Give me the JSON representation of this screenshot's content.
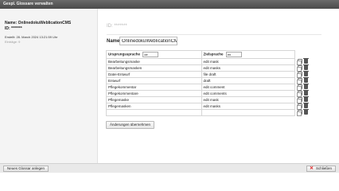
{
  "window": {
    "title": "Gespl. Glossare verwalten"
  },
  "sidebar": {
    "name": "Name: OnlinedokuWebIicationCMS",
    "id": "ID: *******",
    "created": "Erstellt: 28. March 2024 13:21:59 Uhr",
    "entries": "Einträge: 9"
  },
  "detail": {
    "id_display": "ID: *******",
    "name_label": "Name",
    "name_value": "OnlinedokuWebIicationCM",
    "source_lang_label": "Ursprungssprache",
    "source_lang_value": "de",
    "target_lang_label": "Zielsprache",
    "target_lang_value": "en",
    "rows": [
      {
        "source": "Bearbeitungsmaske",
        "target": "edit mask"
      },
      {
        "source": "Bearbeitungsmasken",
        "target": "edit masks"
      },
      {
        "source": "Datei-Entwurf",
        "target": "file draft"
      },
      {
        "source": "Entwurf",
        "target": "draft"
      },
      {
        "source": "Pflegekommentar",
        "target": "edit comment"
      },
      {
        "source": "Pflegekommentare",
        "target": "edit comments"
      },
      {
        "source": "Pflegemaske",
        "target": "edit mask"
      },
      {
        "source": "Pflegemasken",
        "target": "edit masks"
      },
      {
        "source": "",
        "target": ""
      }
    ],
    "apply_label": "Änderungen übernehmen"
  },
  "footer": {
    "new_label": "Neues Glossar anlegen",
    "close_label": "Schließen"
  }
}
